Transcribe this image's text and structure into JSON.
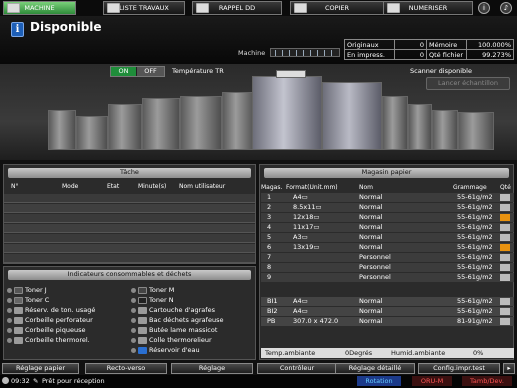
{
  "tabs": [
    "MACHINE",
    "LISTE TRAVAUX",
    "RAPPEL DD",
    "COPIER",
    "NUMERISER"
  ],
  "header": {
    "title": "Disponible",
    "machine_label": "Machine"
  },
  "counters": [
    {
      "label": "Originaux",
      "value": "0",
      "label2": "Mémoire",
      "value2": "100.000%"
    },
    {
      "label": "En impress.",
      "value": "0",
      "label2": "Qté fichier",
      "value2": "99.273%"
    }
  ],
  "power": {
    "on": "ON",
    "off": "OFF",
    "temp_label": "Température TR"
  },
  "scanner": {
    "status": "Scanner disponible",
    "calib_button": "Lancer échantillon"
  },
  "job": {
    "title": "Tâche",
    "columns": [
      "N°",
      "Mode",
      "Etat",
      "Minute(s)",
      "Nom utilisateur"
    ]
  },
  "consumables": {
    "title": "Indicateurs consommables et déchets",
    "left": [
      "Toner J",
      "Toner C",
      "Réserv. de ton. usagé",
      "Corbeille perforateur",
      "Corbeille piqueuse",
      "Corbeille thermorel."
    ],
    "right": [
      "Toner M",
      "Toner N",
      "Cartouche d'agrafes",
      "Bac déchets agrafeuse",
      "Butée lame massicot",
      "Colle thermorelieur",
      "Réservoir d'eau"
    ]
  },
  "paper": {
    "title": "Magasin papier",
    "columns": [
      "Magas.",
      "Format(Unit.mm)",
      "Nom",
      "Grammage",
      "Qté"
    ],
    "trays": [
      {
        "no": "1",
        "fmt": "A4▭",
        "name": "Normal",
        "gsm": "55-61g/m2",
        "qty": "full"
      },
      {
        "no": "2",
        "fmt": "8.5x11▭",
        "name": "Normal",
        "gsm": "55-61g/m2",
        "qty": "full"
      },
      {
        "no": "3",
        "fmt": "12x18▭",
        "name": "Normal",
        "gsm": "55-61g/m2",
        "qty": "low"
      },
      {
        "no": "4",
        "fmt": "11x17▭",
        "name": "Normal",
        "gsm": "55-61g/m2",
        "qty": "full"
      },
      {
        "no": "5",
        "fmt": "A3▭",
        "name": "Normal",
        "gsm": "55-61g/m2",
        "qty": "full"
      },
      {
        "no": "6",
        "fmt": "13x19▭",
        "name": "Normal",
        "gsm": "55-61g/m2",
        "qty": "low"
      },
      {
        "no": "7",
        "fmt": "",
        "name": "Personnel",
        "gsm": "55-61g/m2",
        "qty": "full"
      },
      {
        "no": "8",
        "fmt": "",
        "name": "Personnel",
        "gsm": "55-61g/m2",
        "qty": "full"
      },
      {
        "no": "9",
        "fmt": "",
        "name": "Personnel",
        "gsm": "55-61g/m2",
        "qty": "full"
      }
    ],
    "extra": [
      {
        "no": "BI1",
        "fmt": "A4▭",
        "name": "Normal",
        "gsm": "55-61g/m2"
      },
      {
        "no": "BI2",
        "fmt": "A4▭",
        "name": "Normal",
        "gsm": "55-61g/m2"
      },
      {
        "no": "PB",
        "fmt": "307.0 x 472.0",
        "name": "Normal",
        "gsm": "81-91g/m2"
      }
    ],
    "env": {
      "temp_label": "Temp.ambiante",
      "temp_val": "0Degrés",
      "hum_label": "Humid.ambiante",
      "hum_val": "0%"
    }
  },
  "footer_buttons": [
    "Réglage papier",
    "Recto-verso",
    "Réglage",
    "Contrôleur",
    "Réglage détaillé",
    "Config.impr.test"
  ],
  "status": {
    "time": "09:32",
    "text": "Prêt pour réception",
    "rotation": "Rotation",
    "oru": "ORU-M",
    "tamb": "Tamb/Dev."
  }
}
